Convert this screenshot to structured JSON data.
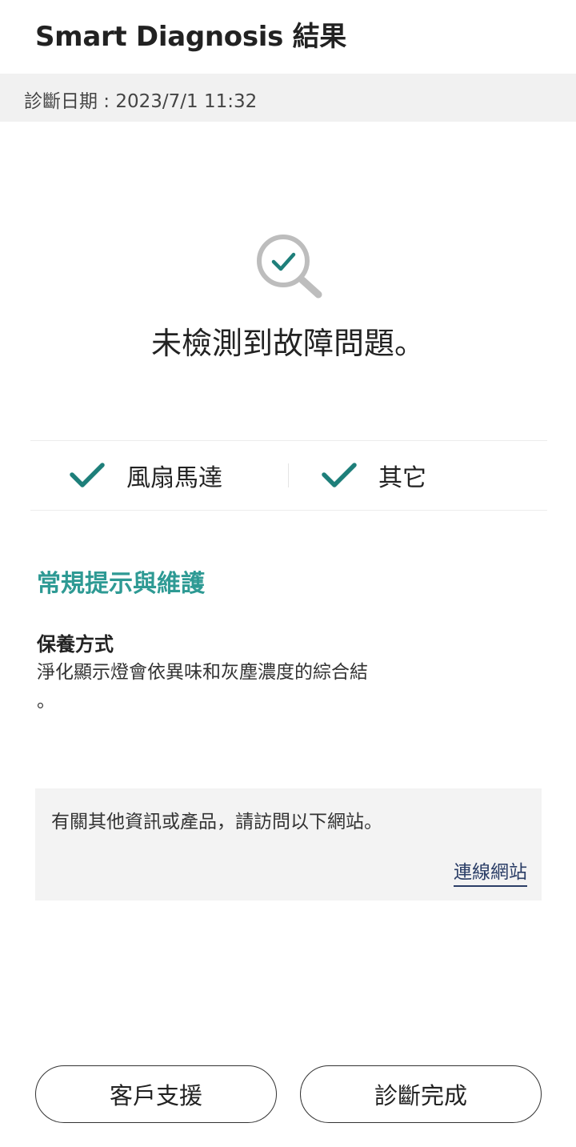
{
  "header": {
    "title": "Smart Diagnosis 結果"
  },
  "date_bar": {
    "text": "診斷日期 : 2023/7/1 11:32"
  },
  "result": {
    "icon": "magnifier-check-icon",
    "message": "未檢測到故障問題。"
  },
  "checks": [
    {
      "label": "風扇馬達",
      "icon": "checkmark-icon"
    },
    {
      "label": "其它",
      "icon": "checkmark-icon"
    }
  ],
  "tips": {
    "section_title": "常規提示與維護",
    "item_title": "保養方式",
    "item_body": "淨化顯示燈會依異味和灰塵濃度的綜合結\n。"
  },
  "info_box": {
    "text": "有關其他資訊或產品，請訪問以下網站。",
    "link_label": "連線網站"
  },
  "buttons": {
    "support_label": "客戶支援",
    "done_label": "診斷完成"
  },
  "colors": {
    "accent_teal": "#2e9a94",
    "check_teal": "#1e7f7a",
    "link_navy": "#2a3d66",
    "gray_bar": "#f1f1f1"
  }
}
